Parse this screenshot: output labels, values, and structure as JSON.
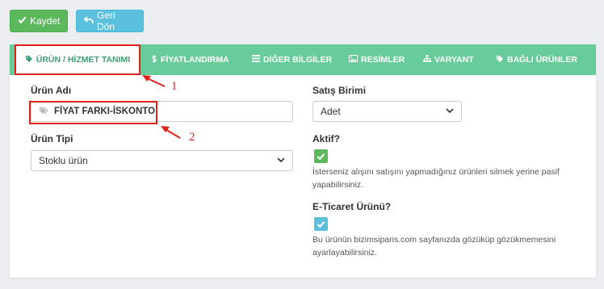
{
  "toolbar": {
    "save_label": "Kaydet",
    "back_label": "Geri Dön"
  },
  "tabs": [
    {
      "label": "ÜRÜN / HİZMET TANIMI",
      "icon": "tag-icon",
      "active": true
    },
    {
      "label": "FİYATLANDIRMA",
      "icon": "money-icon"
    },
    {
      "label": "DİĞER BİLGİLER",
      "icon": "list-icon"
    },
    {
      "label": "RESİMLER",
      "icon": "image-icon"
    },
    {
      "label": "VARYANT",
      "icon": "sitemap-icon"
    },
    {
      "label": "BAĞLI ÜRÜNLER",
      "icon": "tag-icon"
    }
  ],
  "form": {
    "product_name_label": "Ürün Adı",
    "product_name_value": "FİYAT FARKI-İSKONTO",
    "product_type_label": "Ürün Tipi",
    "product_type_value": "Stoklu ürün",
    "unit_label": "Satış Birimi",
    "unit_value": "Adet",
    "active_label": "Aktif?",
    "active_checked": true,
    "active_help": "İsterseniz alışını satışını yapmadığınız ürünleri silmek yerine pasif yapabilirsiniz.",
    "ecommerce_label": "E-Ticaret Ürünü?",
    "ecommerce_checked": true,
    "ecommerce_help": "Bu ürünün bizimsiparis.com sayfanızda gözüküp gözükmemesini ayarlayabilirsiniz."
  },
  "annotations": {
    "marker1": "1",
    "marker2": "2"
  },
  "colors": {
    "tabbar": "#67cc9a",
    "save": "#5cb85c",
    "back": "#5bc0de",
    "annotation": "#e0201a",
    "active_checkbox": "#5cb85c",
    "ecommerce_checkbox": "#5bc0de"
  }
}
